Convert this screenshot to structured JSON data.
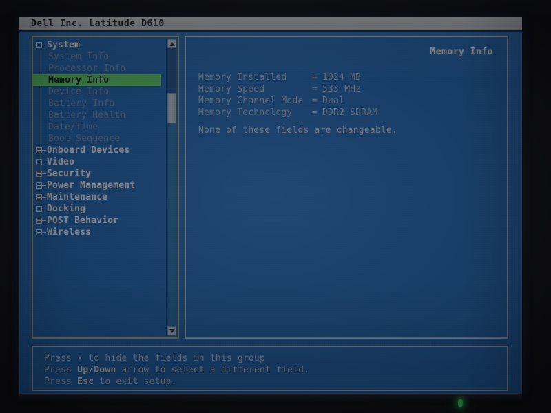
{
  "window": {
    "title": "Dell Inc. Latitude D610"
  },
  "colors": {
    "screen_blue": "#1a6fc4",
    "highlight_green": "#63e06a",
    "tree_border": "#cdbf84",
    "panel_border": "#c3d6ef",
    "dim_text": "#7e93b9",
    "bright_text": "#ffffff",
    "title_bar_bg": "#dadde0",
    "power_led": "#2ad14a"
  },
  "tree": {
    "items": [
      {
        "label": "System",
        "level": 0,
        "expander": "minus",
        "state": "expanded",
        "selected": false
      },
      {
        "label": "System Info",
        "level": 1,
        "expander": "none",
        "state": "dim",
        "selected": false
      },
      {
        "label": "Processor Info",
        "level": 1,
        "expander": "none",
        "state": "dim",
        "selected": false
      },
      {
        "label": "Memory Info",
        "level": 1,
        "expander": "none",
        "state": "dim",
        "selected": true
      },
      {
        "label": "Device Info",
        "level": 1,
        "expander": "none",
        "state": "dim",
        "selected": false
      },
      {
        "label": "Battery Info",
        "level": 1,
        "expander": "none",
        "state": "dim",
        "selected": false
      },
      {
        "label": "Battery Health",
        "level": 1,
        "expander": "none",
        "state": "dim",
        "selected": false
      },
      {
        "label": "Date/Time",
        "level": 1,
        "expander": "none",
        "state": "dim",
        "selected": false
      },
      {
        "label": "Boot Sequence",
        "level": 1,
        "expander": "none",
        "state": "dim",
        "selected": false
      },
      {
        "label": "Onboard Devices",
        "level": 0,
        "expander": "plus",
        "state": "collapsed",
        "selected": false
      },
      {
        "label": "Video",
        "level": 0,
        "expander": "plus",
        "state": "collapsed",
        "selected": false
      },
      {
        "label": "Security",
        "level": 0,
        "expander": "plus",
        "state": "collapsed",
        "selected": false
      },
      {
        "label": "Power Management",
        "level": 0,
        "expander": "plus",
        "state": "collapsed",
        "selected": false
      },
      {
        "label": "Maintenance",
        "level": 0,
        "expander": "plus",
        "state": "collapsed",
        "selected": false
      },
      {
        "label": "Docking",
        "level": 0,
        "expander": "plus",
        "state": "collapsed",
        "selected": false
      },
      {
        "label": "POST Behavior",
        "level": 0,
        "expander": "plus",
        "state": "collapsed",
        "selected": false
      },
      {
        "label": "Wireless",
        "level": 0,
        "expander": "plus",
        "state": "collapsed",
        "selected": false
      }
    ],
    "scrollbar": {
      "up_arrow": "scroll-up-arrow",
      "down_arrow": "scroll-down-arrow",
      "thumb_position_pct": 18
    }
  },
  "content": {
    "title": "Memory Info",
    "fields": [
      {
        "name": "Memory Installed",
        "eq": "=",
        "value": "1024 MB"
      },
      {
        "name": "Memory Speed",
        "eq": "=",
        "value": "533 MHz"
      },
      {
        "name": "Memory Channel Mode",
        "eq": "=",
        "value": "Dual"
      },
      {
        "name": "Memory Technology",
        "eq": "=",
        "value": "DDR2 SDRAM"
      }
    ],
    "note": "None of these fields are changeable."
  },
  "footer": {
    "lines": [
      {
        "pre": "Press ",
        "key": "-",
        "post": " to hide the fields in this group"
      },
      {
        "pre": "Press ",
        "key": "Up/Down",
        "post": " arrow to select a different field."
      },
      {
        "pre": "Press ",
        "key": "Esc",
        "post": " to exit setup."
      }
    ]
  }
}
